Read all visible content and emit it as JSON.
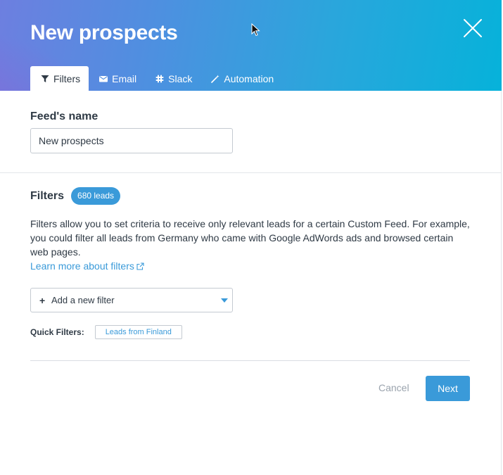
{
  "header": {
    "title": "New prospects",
    "tabs": [
      {
        "label": "Filters",
        "icon": "filter-icon",
        "active": true
      },
      {
        "label": "Email",
        "icon": "envelope-icon",
        "active": false
      },
      {
        "label": "Slack",
        "icon": "slack-icon",
        "active": false
      },
      {
        "label": "Automation",
        "icon": "magic-wand-icon",
        "active": false
      }
    ],
    "close_icon": "close-icon"
  },
  "feed": {
    "label": "Feed's name",
    "value": "New prospects"
  },
  "filters": {
    "heading": "Filters",
    "badge": "680 leads",
    "description": "Filters allow you to set criteria to receive only relevant leads for a certain Custom Feed. For example, you could filter all leads from Germany who came with Google AdWords ads and browsed certain web pages.",
    "learn_more": "Learn more about filters",
    "add_filter": {
      "plus": "+",
      "label": "Add a new filter"
    },
    "quick_label": "Quick Filters:",
    "quick_items": [
      "Leads from Finland"
    ]
  },
  "footer": {
    "cancel": "Cancel",
    "next": "Next"
  },
  "colors": {
    "accent": "#3a9ad9",
    "text": "#2f3a45",
    "muted": "#9aa3ad",
    "header_gradient_start": "#6d7fe0",
    "header_gradient_end": "#06b2da"
  }
}
